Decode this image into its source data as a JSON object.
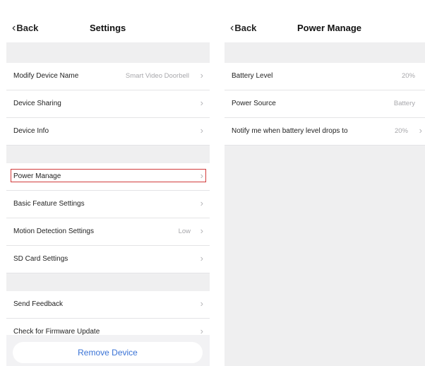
{
  "settings": {
    "back_label": "Back",
    "title": "Settings",
    "rows": [
      {
        "label": "Modify Device Name",
        "value": "Smart Video Doorbell"
      },
      {
        "label": "Device Sharing",
        "value": ""
      },
      {
        "label": "Device Info",
        "value": ""
      },
      {
        "label": "Power Manage",
        "value": ""
      },
      {
        "label": "Basic Feature Settings",
        "value": ""
      },
      {
        "label": "Motion Detection Settings",
        "value": "Low"
      },
      {
        "label": "SD Card Settings",
        "value": ""
      },
      {
        "label": "Send Feedback",
        "value": ""
      },
      {
        "label": "Check for Firmware Update",
        "value": ""
      }
    ],
    "remove_button": "Remove Device"
  },
  "power_manage": {
    "back_label": "Back",
    "title": "Power Manage",
    "rows": [
      {
        "label": "Battery Level",
        "value": "20%"
      },
      {
        "label": "Power Source",
        "value": "Battery"
      },
      {
        "label": "Notify me when battery level drops to",
        "value": "20%"
      }
    ]
  },
  "colors": {
    "highlight": "#d23b3b",
    "accent": "#3a73d6",
    "section_gap": "#efeff0"
  },
  "icons": {
    "back": "chevron-left-icon",
    "row_chevron": "chevron-right-icon"
  }
}
